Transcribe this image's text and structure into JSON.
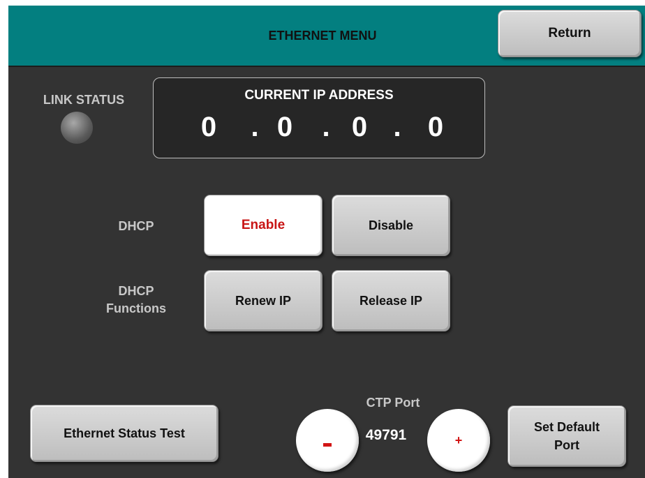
{
  "header": {
    "title": "ETHERNET MENU",
    "return_label": "Return"
  },
  "link_status": {
    "label": "LINK STATUS"
  },
  "ip": {
    "title": "CURRENT IP ADDRESS",
    "octets": [
      "0",
      "0",
      "0",
      "0"
    ],
    "separator": "."
  },
  "dhcp": {
    "label": "DHCP",
    "enable_label": "Enable",
    "disable_label": "Disable"
  },
  "dhcp_functions": {
    "label_line1": "DHCP",
    "label_line2": "Functions",
    "renew_label": "Renew IP",
    "release_label": "Release IP"
  },
  "status_test": {
    "label": "Ethernet Status Test"
  },
  "ctp_port": {
    "label": "CTP Port",
    "value": "49791",
    "minus_icon": "minus-icon",
    "plus_symbol": "+",
    "set_default_line1": "Set Default",
    "set_default_line2": "Port"
  },
  "colors": {
    "header": "#037f80",
    "background": "#333333",
    "accent_red": "#d21515"
  }
}
